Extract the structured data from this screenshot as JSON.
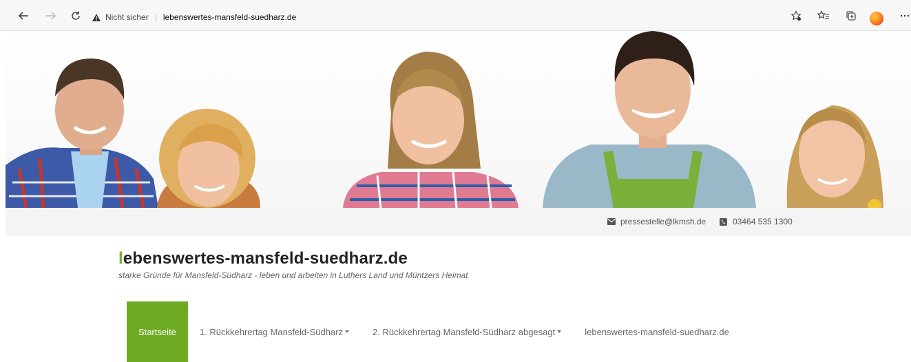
{
  "browser": {
    "insecure_label": "Nicht sicher",
    "url": "lebenswertes-mansfeld-suedharz.de",
    "icons": [
      "back-icon",
      "forward-icon",
      "reload-icon",
      "warning-icon",
      "favorite-add-icon",
      "favorites-icon",
      "collections-icon",
      "profile-avatar",
      "more-icon"
    ]
  },
  "hero": {
    "description_icon": "people-banner-image"
  },
  "contact": {
    "email": "pressestelle@lkmsh.de",
    "phone": "03464 535 1300"
  },
  "site": {
    "title_first_letter": "l",
    "title_rest": "ebenswertes-mansfeld-suedharz.de",
    "tagline": "starke Gründe für Mansfeld-Südharz - leben und arbeiten in Luthers Land und Müntzers Heimat"
  },
  "menu": {
    "items": [
      {
        "label": "Startseite"
      },
      {
        "label": "1. Rückkehrertag Mansfeld-Südharz"
      },
      {
        "label": "2. Rückkehrertag Mansfeld-Südharz abgesagt"
      },
      {
        "label": "lebenswertes-mansfeld-suedharz.de"
      }
    ]
  },
  "colors": {
    "accent_green": "#6eab24",
    "title_letter_green": "#76b82a"
  }
}
